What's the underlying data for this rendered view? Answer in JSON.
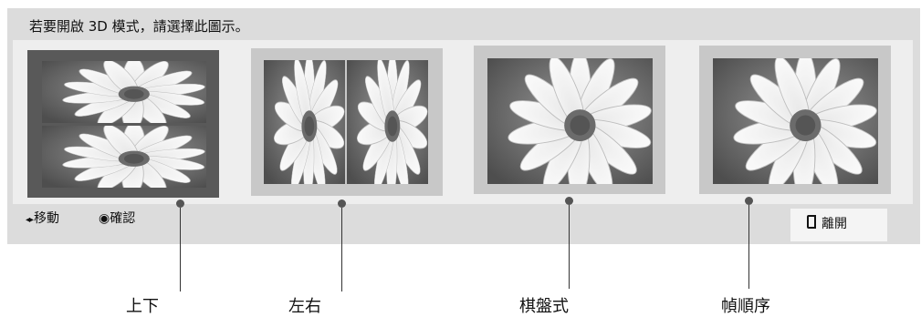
{
  "instruction": "若要開啟 3D 模式，請選擇此圖示。",
  "modes": [
    {
      "label": "上下",
      "layout": "top-bottom",
      "selected": true
    },
    {
      "label": "左右",
      "layout": "side-by-side",
      "selected": false
    },
    {
      "label": "棋盤式",
      "layout": "checkerboard",
      "selected": false
    },
    {
      "label": "幀順序",
      "layout": "frame-sequential",
      "selected": false
    }
  ],
  "hints": {
    "move_glyph": "◂▸",
    "move": "移動",
    "confirm_glyph": "◉",
    "confirm": "確認"
  },
  "exit": {
    "label": "離開",
    "icon": "exit-icon"
  },
  "colors": {
    "panel": "#dcdcdc",
    "strip": "#eeeeee",
    "selected_frame": "#595959",
    "frame": "#c8c8c8"
  }
}
